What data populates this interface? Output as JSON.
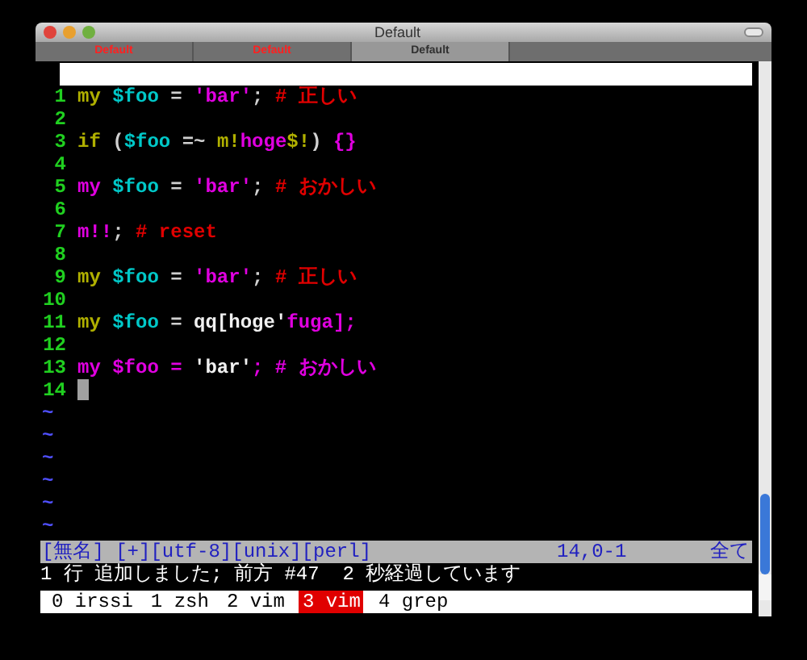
{
  "window": {
    "title": "Default"
  },
  "tabs": [
    {
      "label": "Default",
      "selected": false,
      "activity": true
    },
    {
      "label": "Default",
      "selected": false,
      "activity": true
    },
    {
      "label": "Default",
      "selected": true,
      "activity": false
    }
  ],
  "editor": {
    "lines": [
      {
        "number": "1",
        "tokens": [
          {
            "text": "my ",
            "color": "#b0b000"
          },
          {
            "text": "$foo",
            "color": "#00c8c8"
          },
          {
            "text": " = ",
            "color": "#d0d0d0"
          },
          {
            "text": "'bar'",
            "color": "#e000e0"
          },
          {
            "text": "; ",
            "color": "#d0d0d0"
          },
          {
            "text": "# 正しい",
            "color": "#e00000"
          }
        ]
      },
      {
        "number": "2"
      },
      {
        "number": "3",
        "tokens": [
          {
            "text": "if ",
            "color": "#b0b000"
          },
          {
            "text": "(",
            "color": "#d0d0d0"
          },
          {
            "text": "$foo",
            "color": "#00c8c8"
          },
          {
            "text": " =~ ",
            "color": "#d0d0d0"
          },
          {
            "text": "m!",
            "color": "#b0b000"
          },
          {
            "text": "hoge",
            "color": "#e000e0"
          },
          {
            "text": "$!",
            "color": "#b0b000"
          },
          {
            "text": ") ",
            "color": "#d0d0d0"
          },
          {
            "text": "{}",
            "color": "#e000e0"
          }
        ]
      },
      {
        "number": "4"
      },
      {
        "number": "5",
        "tokens": [
          {
            "text": "my ",
            "color": "#e000e0"
          },
          {
            "text": "$foo",
            "color": "#00c8c8"
          },
          {
            "text": " = ",
            "color": "#d0d0d0"
          },
          {
            "text": "'bar'",
            "color": "#e000e0"
          },
          {
            "text": "; ",
            "color": "#d0d0d0"
          },
          {
            "text": "# おかしい",
            "color": "#e00000"
          }
        ]
      },
      {
        "number": "6"
      },
      {
        "number": "7",
        "tokens": [
          {
            "text": "m!!",
            "color": "#e000e0"
          },
          {
            "text": "; ",
            "color": "#d0d0d0"
          },
          {
            "text": "# reset",
            "color": "#e00000"
          }
        ]
      },
      {
        "number": "8"
      },
      {
        "number": "9",
        "tokens": [
          {
            "text": "my ",
            "color": "#b0b000"
          },
          {
            "text": "$foo",
            "color": "#00c8c8"
          },
          {
            "text": " = ",
            "color": "#d0d0d0"
          },
          {
            "text": "'bar'",
            "color": "#e000e0"
          },
          {
            "text": "; ",
            "color": "#d0d0d0"
          },
          {
            "text": "# 正しい",
            "color": "#e00000"
          }
        ]
      },
      {
        "number": "10"
      },
      {
        "number": "11",
        "tokens": [
          {
            "text": "my ",
            "color": "#b0b000"
          },
          {
            "text": "$foo",
            "color": "#00c8c8"
          },
          {
            "text": " = ",
            "color": "#d0d0d0"
          },
          {
            "text": "qq[hoge'",
            "color": "#f0f0f0"
          },
          {
            "text": "fuga",
            "color": "#e000e0"
          },
          {
            "text": "];",
            "color": "#e000e0"
          }
        ]
      },
      {
        "number": "12"
      },
      {
        "number": "13",
        "tokens": [
          {
            "text": "my $foo = ",
            "color": "#e000e0"
          },
          {
            "text": "'bar'",
            "color": "#f0f0f0"
          },
          {
            "text": "; # おかしい",
            "color": "#e000e0"
          }
        ]
      },
      {
        "number": "14",
        "cursor": true
      }
    ],
    "tildes": [
      "~",
      "~",
      "~",
      "~",
      "~",
      "~"
    ]
  },
  "status_line": {
    "left": "[無名] [+][utf-8][unix][perl]",
    "position": "14,0-1",
    "scroll": "全て"
  },
  "message": "1 行 追加しました; 前方 #47  2 秒経過しています",
  "screen_windows": [
    {
      "label": "0 irssi",
      "selected": false
    },
    {
      "label": "1 zsh",
      "selected": false
    },
    {
      "label": "2 vim",
      "selected": false
    },
    {
      "label": "3 vim",
      "selected": true
    },
    {
      "label": "4 grep",
      "selected": false
    }
  ]
}
